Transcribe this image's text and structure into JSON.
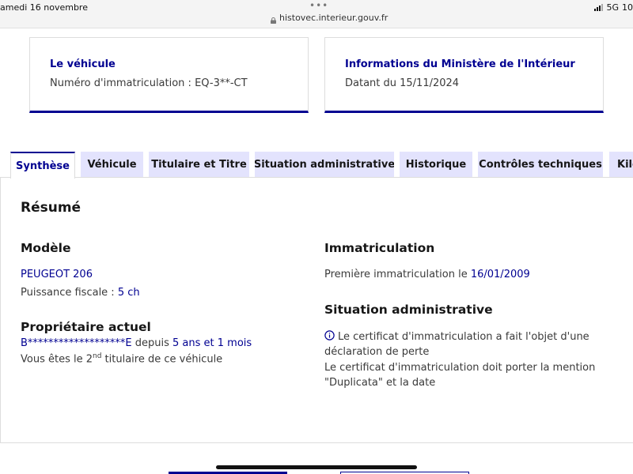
{
  "status_bar": {
    "date": "amedi 16 novembre",
    "menu_dots": "•••",
    "url": "histovec.interieur.gouv.fr",
    "network": "5G",
    "battery": "10"
  },
  "cards": {
    "vehicle": {
      "title": "Le véhicule",
      "text": "Numéro d'immatriculation : EQ-3**-CT"
    },
    "ministry": {
      "title": "Informations du Ministère de l'Intérieur",
      "text": "Datant du 15/11/2024"
    }
  },
  "tabs": [
    {
      "label": "Synthèse",
      "active": true
    },
    {
      "label": "Véhicule",
      "active": false
    },
    {
      "label": "Titulaire et Titre",
      "active": false
    },
    {
      "label": "Situation administrative",
      "active": false
    },
    {
      "label": "Historique",
      "active": false
    },
    {
      "label": "Contrôles techniques",
      "active": false
    },
    {
      "label": "Kilo",
      "active": false
    }
  ],
  "summary": {
    "title": "Résumé",
    "model": {
      "heading": "Modèle",
      "name": "PEUGEOT 206",
      "power_label": "Puissance fiscale : ",
      "power_value": "5 ch"
    },
    "owner": {
      "heading": "Propriétaire actuel",
      "name": "B*******************E",
      "since_label": " depuis ",
      "since_value": "5 ans et 1 mois",
      "rank_prefix": "Vous êtes le 2",
      "rank_sup": "nd",
      "rank_suffix": " titulaire de ce véhicule"
    },
    "registration": {
      "heading": "Immatriculation",
      "first_label": "Première immatriculation le ",
      "first_date": "16/01/2009"
    },
    "admin": {
      "heading": "Situation administrative",
      "line1": "Le certificat d'immatriculation a fait l'objet d'une",
      "line2": "déclaration de perte",
      "line3": "Le certificat d'immatriculation doit porter la mention",
      "line4": "\"Duplicata\" et la date"
    }
  },
  "colors": {
    "accent": "#000091",
    "tab_bg": "#e3e3fd",
    "text": "#161616",
    "muted_text": "#3a3a3a",
    "border": "#dddddd"
  },
  "icons": {
    "lock": "lock-icon",
    "signal": "signal-icon",
    "info": "info-icon"
  }
}
